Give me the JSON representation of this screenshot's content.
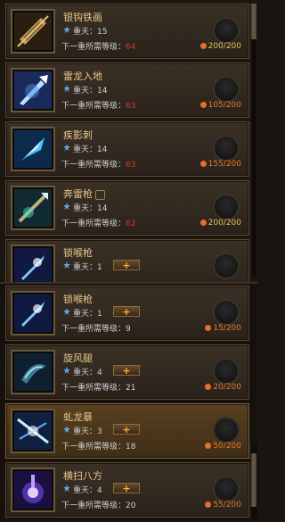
{
  "top_list": {
    "items": [
      {
        "name": "银钩铁画",
        "rank": "重天：15",
        "req_label": "下一重所需等级：",
        "req_value": "64",
        "req_color": "red",
        "points": "200/200",
        "points_color": "gold",
        "has_plus": false,
        "has_badge": false,
        "icon": "paper-scroll-icon"
      },
      {
        "name": "雷龙入地",
        "rank": "重天：14",
        "req_label": "下一重所需等级：",
        "req_value": "63",
        "req_color": "red",
        "points": "105/200",
        "points_color": "orange",
        "has_plus": false,
        "has_badge": false,
        "icon": "lightning-spear-icon"
      },
      {
        "name": "疾影刺",
        "rank": "重天：14",
        "req_label": "下一重所需等级：",
        "req_value": "63",
        "req_color": "red",
        "points": "155/200",
        "points_color": "orange",
        "has_plus": false,
        "has_badge": false,
        "icon": "blue-blade-icon"
      },
      {
        "name": "奔雷枪",
        "rank": "重天：14",
        "req_label": "下一重所需等级：",
        "req_value": "62",
        "req_color": "red",
        "points": "200/200",
        "points_color": "gold",
        "has_plus": false,
        "has_badge": true,
        "icon": "spear-thrust-icon"
      },
      {
        "name": "锁喉枪",
        "rank": "重天：1",
        "req_label": "",
        "req_value": "",
        "req_color": "white",
        "points": "",
        "points_color": "orange",
        "has_plus": true,
        "has_badge": false,
        "icon": "spear-blue-icon"
      }
    ]
  },
  "bottom_list": {
    "items": [
      {
        "name": "锁喉枪",
        "rank": "重天：1",
        "req_label": "下一重所需等级：",
        "req_value": "9",
        "req_color": "white",
        "points": "15/200",
        "points_color": "orange",
        "has_plus": true,
        "selected": false,
        "icon": "spear-blue-icon"
      },
      {
        "name": "旋风腿",
        "rank": "重天：4",
        "req_label": "下一重所需等级：",
        "req_value": "21",
        "req_color": "white",
        "points": "20/200",
        "points_color": "orange",
        "has_plus": true,
        "selected": false,
        "icon": "whirlwind-kick-icon"
      },
      {
        "name": "虬龙暴",
        "rank": "重天：3",
        "req_label": "下一重所需等级：",
        "req_value": "18",
        "req_color": "white",
        "points": "50/200",
        "points_color": "orange",
        "has_plus": true,
        "selected": true,
        "icon": "dragon-burst-icon"
      },
      {
        "name": "横扫八方",
        "rank": "重天：4",
        "req_label": "下一重所需等级：",
        "req_value": "20",
        "req_color": "white",
        "points": "55/200",
        "points_color": "orange",
        "has_plus": true,
        "selected": false,
        "icon": "sweep-purple-icon"
      }
    ]
  },
  "plus_label": "+",
  "colors": {
    "name": "#e8c88a",
    "red": "#d03a2a",
    "orange": "#e87a2a",
    "gold": "#e8c060"
  }
}
